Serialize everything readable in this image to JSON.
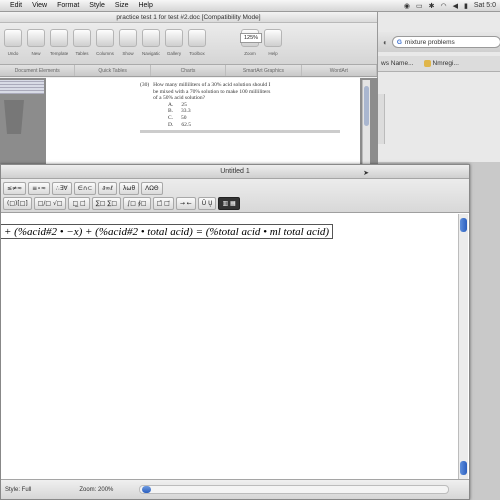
{
  "menubar": {
    "items": [
      "Edit",
      "View",
      "Format",
      "Style",
      "Size",
      "Help"
    ],
    "clock": "Sat 5:0"
  },
  "browser": {
    "search_value": "mixture problems",
    "bookmarks": [
      "ws Name...",
      "Nmregi..."
    ]
  },
  "word": {
    "title": "practice test 1 for test #2.doc [Compatibility Mode]",
    "toolbar_labels": [
      "Undo",
      "New",
      "Templates",
      "Tables",
      "Columns",
      "Show",
      "Navigation",
      "Gallery",
      "Toolbox",
      "Zoom",
      "Help"
    ],
    "zoom_value": "125%",
    "ribbon_tabs": [
      "Document Elements",
      "Quick Tables",
      "Charts",
      "SmartArt Graphics",
      "WordArt"
    ],
    "question": {
      "number": "(30)",
      "text": "How many milliliters of a 30% acid solution should I be mixed with a 70% solution to make 100 milliliters of a 50% acid solution?",
      "choices": [
        {
          "letter": "A.",
          "value": "25"
        },
        {
          "letter": "B.",
          "value": "33.3"
        },
        {
          "letter": "C.",
          "value": "50"
        },
        {
          "letter": "D.",
          "value": "62.5"
        }
      ]
    }
  },
  "equation_editor": {
    "title": "Untitled 1",
    "palette_row1": [
      "≤≠≈",
      "≡∘≈",
      "∴∃∀",
      "∈∩⊂",
      "∂∞ℓ",
      "λωθ",
      "ΛΩΘ"
    ],
    "palette_row2": [
      "(□)[□]",
      "□/□ √□",
      "□̲ □̇",
      "∑□ ∑□",
      "∫□ ∮□",
      "□̄ □⃗",
      "→ ←",
      "Ū Ų",
      "▥ ▦"
    ],
    "formula": "+ (%acid#2 • −x) + (%acid#2 • total  acid) = (%total  acid • ml  total  acid)",
    "status_style": "Style: Full",
    "status_zoom": "Zoom: 200%"
  }
}
